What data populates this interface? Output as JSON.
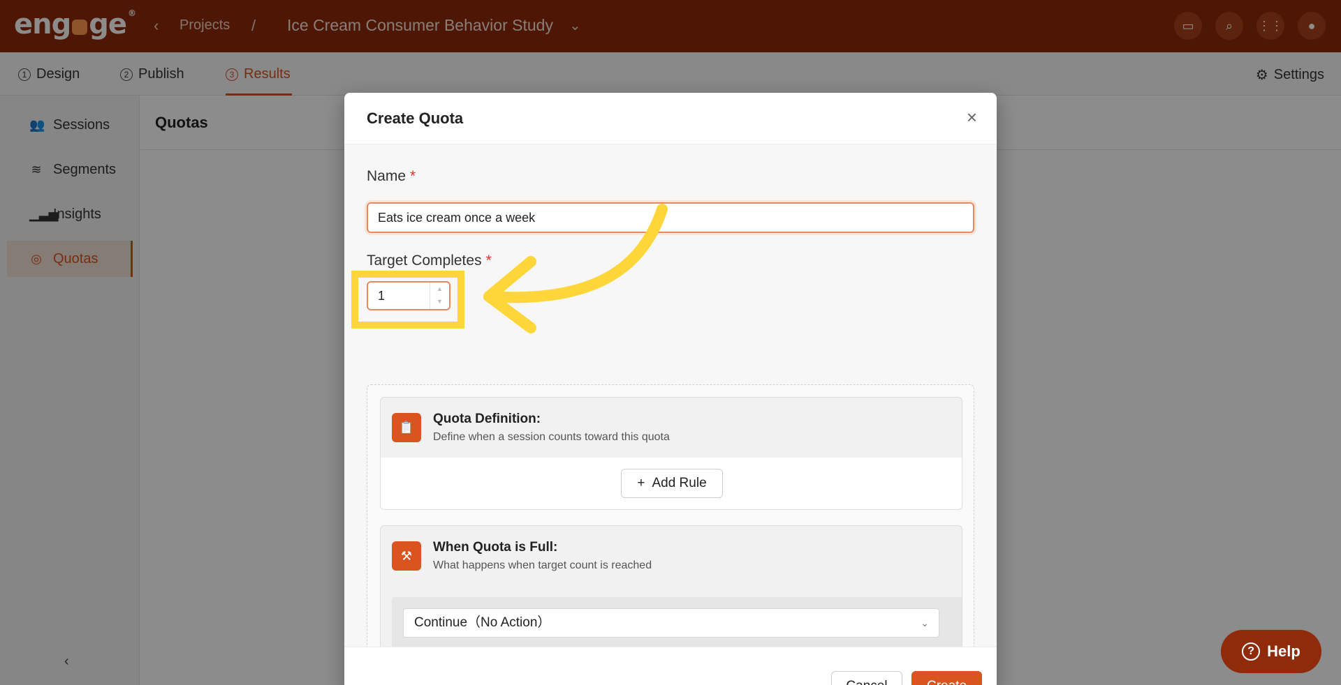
{
  "brand": {
    "logo_text_pre": "eng",
    "logo_text_post": "ge",
    "registered": "®"
  },
  "breadcrumb": {
    "back_icon": "chevron-left-icon",
    "projects": "Projects",
    "separator": "/",
    "project": "Ice Cream Consumer Behavior Study"
  },
  "tabs": [
    {
      "num": "1",
      "label": "Design"
    },
    {
      "num": "2",
      "label": "Publish"
    },
    {
      "num": "3",
      "label": "Results"
    }
  ],
  "settings_label": "Settings",
  "sidebar": {
    "items": [
      {
        "label": "Sessions",
        "icon": "users-icon"
      },
      {
        "label": "Segments",
        "icon": "layers-icon"
      },
      {
        "label": "Insights",
        "icon": "chart-icon"
      },
      {
        "label": "Quotas",
        "icon": "target-icon"
      }
    ],
    "collapse_glyph": "‹"
  },
  "page_title": "Quotas",
  "modal": {
    "title": "Create Quota",
    "close_glyph": "×",
    "name_label": "Name",
    "required_mark": "*",
    "name_value": "Eats ice cream once a week",
    "target_label": "Target Completes",
    "target_value": "1",
    "definition": {
      "title": "Quota Definition:",
      "subtitle": "Define when a session counts toward this quota",
      "add_rule_label": "Add Rule",
      "plus_glyph": "+"
    },
    "full": {
      "title": "When Quota is Full:",
      "subtitle": "What happens when target count is reached",
      "selected": "Continue（No Action）"
    },
    "cancel_label": "Cancel",
    "create_label": "Create"
  },
  "help_label": "Help",
  "colors": {
    "brand": "#8f2a0a",
    "accent": "#d9541e",
    "highlight": "#ffd63a"
  }
}
